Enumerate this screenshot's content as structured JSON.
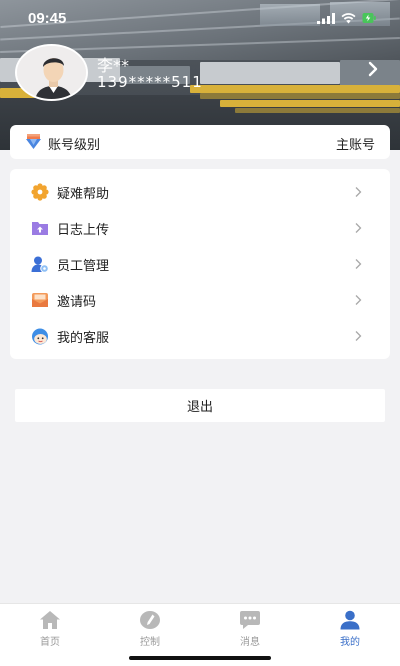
{
  "status_bar": {
    "time": "09:45"
  },
  "profile": {
    "name": "李**",
    "phone": "139*****511"
  },
  "account_level": {
    "label": "账号级别",
    "value": "主账号"
  },
  "menu": {
    "items": [
      {
        "label": "疑难帮助",
        "icon": "help-gear-icon"
      },
      {
        "label": "日志上传",
        "icon": "upload-folder-icon"
      },
      {
        "label": "员工管理",
        "icon": "staff-management-icon"
      },
      {
        "label": "邀请码",
        "icon": "invite-envelope-icon"
      },
      {
        "label": "我的客服",
        "icon": "customer-service-icon"
      }
    ]
  },
  "logout": {
    "label": "退出"
  },
  "tabs": [
    {
      "label": "首页",
      "icon": "home-icon",
      "active": false
    },
    {
      "label": "控制",
      "icon": "control-icon",
      "active": false
    },
    {
      "label": "消息",
      "icon": "message-icon",
      "active": false
    },
    {
      "label": "我的",
      "icon": "profile-icon",
      "active": true
    }
  ],
  "colors": {
    "accent": "#3a6fc8",
    "background": "#f2f2f4",
    "tab_inactive": "#9a9a9a"
  }
}
